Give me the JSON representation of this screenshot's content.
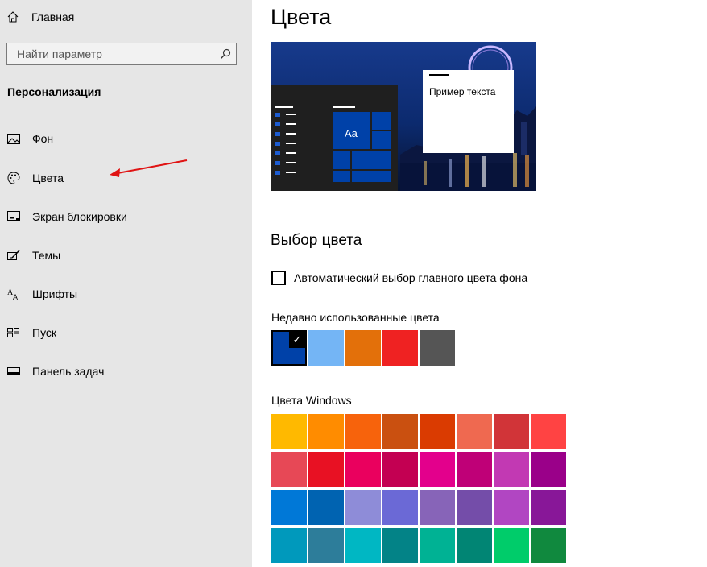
{
  "sidebar": {
    "home_label": "Главная",
    "search_placeholder": "Найти параметр",
    "section_title": "Персонализация",
    "items": [
      {
        "label": "Фон",
        "icon": "picture-icon"
      },
      {
        "label": "Цвета",
        "icon": "palette-icon"
      },
      {
        "label": "Экран блокировки",
        "icon": "lock-screen-icon"
      },
      {
        "label": "Темы",
        "icon": "themes-icon"
      },
      {
        "label": "Шрифты",
        "icon": "fonts-icon"
      },
      {
        "label": "Пуск",
        "icon": "start-icon"
      },
      {
        "label": "Панель задач",
        "icon": "taskbar-icon"
      }
    ]
  },
  "main": {
    "title": "Цвета",
    "preview": {
      "tile_text": "Aa",
      "sample_text": "Пример текста"
    },
    "color_choice_heading": "Выбор цвета",
    "auto_color_label": "Автоматический выбор главного цвета фона",
    "recent_label": "Недавно использованные цвета",
    "recent_colors": [
      "#0041a8",
      "#74b5f5",
      "#e3700a",
      "#ef2222",
      "#555555"
    ],
    "selected_recent_index": 0,
    "windows_label": "Цвета Windows",
    "windows_colors": [
      [
        "#ffb900",
        "#ff8c00",
        "#f7630c",
        "#ca5010",
        "#da3b01",
        "#ef6950",
        "#d13438",
        "#ff4343"
      ],
      [
        "#e74856",
        "#e81123",
        "#ea005e",
        "#c30052",
        "#e3008c",
        "#bf0077",
        "#c239b3",
        "#9a0089"
      ],
      [
        "#0078d7",
        "#0063b1",
        "#8e8cd8",
        "#6b69d6",
        "#8764b8",
        "#744da9",
        "#b146c2",
        "#881798"
      ],
      [
        "#0099bc",
        "#2d7d9a",
        "#00b7c3",
        "#038387",
        "#00b294",
        "#018574",
        "#00cc6a",
        "#10893e"
      ]
    ]
  }
}
